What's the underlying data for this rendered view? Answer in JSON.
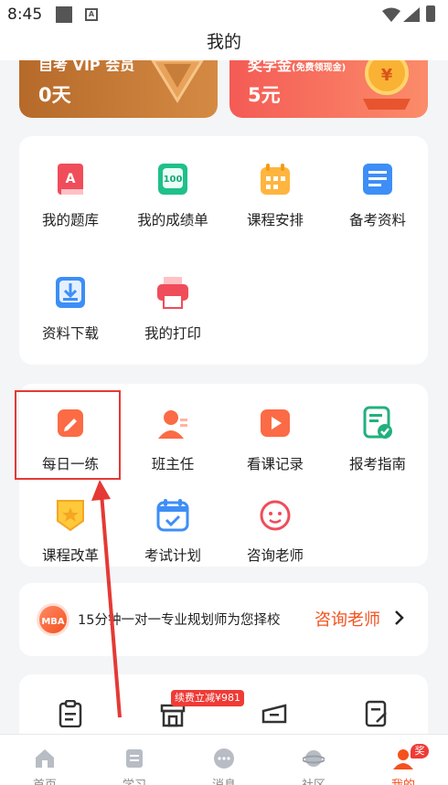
{
  "status_bar": {
    "time": "8:45"
  },
  "header": {
    "title": "我的"
  },
  "vip_card": {
    "title": "自考 VIP 会员",
    "value": "0天"
  },
  "scholarship_card": {
    "title": "奖学金",
    "subtitle": "(免费领现金)",
    "value": "5元"
  },
  "tools": {
    "items": [
      {
        "label": "我的题库",
        "icon": "question-bank-icon"
      },
      {
        "label": "我的成绩单",
        "icon": "transcript-icon"
      },
      {
        "label": "课程安排",
        "icon": "calendar-icon"
      },
      {
        "label": "备考资料",
        "icon": "materials-icon"
      },
      {
        "label": "资料下载",
        "icon": "download-icon"
      },
      {
        "label": "我的打印",
        "icon": "printer-icon"
      }
    ]
  },
  "services": {
    "items": [
      {
        "label": "每日一练",
        "icon": "daily-practice-icon"
      },
      {
        "label": "班主任",
        "icon": "class-teacher-icon"
      },
      {
        "label": "看课记录",
        "icon": "watch-history-icon"
      },
      {
        "label": "报考指南",
        "icon": "exam-guide-icon"
      },
      {
        "label": "课程改革",
        "icon": "course-reform-icon"
      },
      {
        "label": "考试计划",
        "icon": "exam-plan-icon"
      },
      {
        "label": "咨询老师",
        "icon": "consult-teacher-icon"
      }
    ]
  },
  "banner": {
    "badge": "MBA",
    "text": "15分钟一对一专业规划师为您择校",
    "link": "咨询老师"
  },
  "promo": {
    "badge": "续费立减¥981"
  },
  "tabbar": {
    "items": [
      {
        "label": "首页",
        "icon": "home-icon"
      },
      {
        "label": "学习",
        "icon": "study-icon"
      },
      {
        "label": "消息",
        "icon": "message-icon"
      },
      {
        "label": "社区",
        "icon": "community-icon"
      },
      {
        "label": "我的",
        "icon": "profile-icon"
      }
    ],
    "active": "我的",
    "profile_badge": "奖"
  },
  "colors": {
    "accent": "#f4511e",
    "highlight_box": "#e53935",
    "vip": "#c27631",
    "scholarship": "#f76a5c"
  }
}
